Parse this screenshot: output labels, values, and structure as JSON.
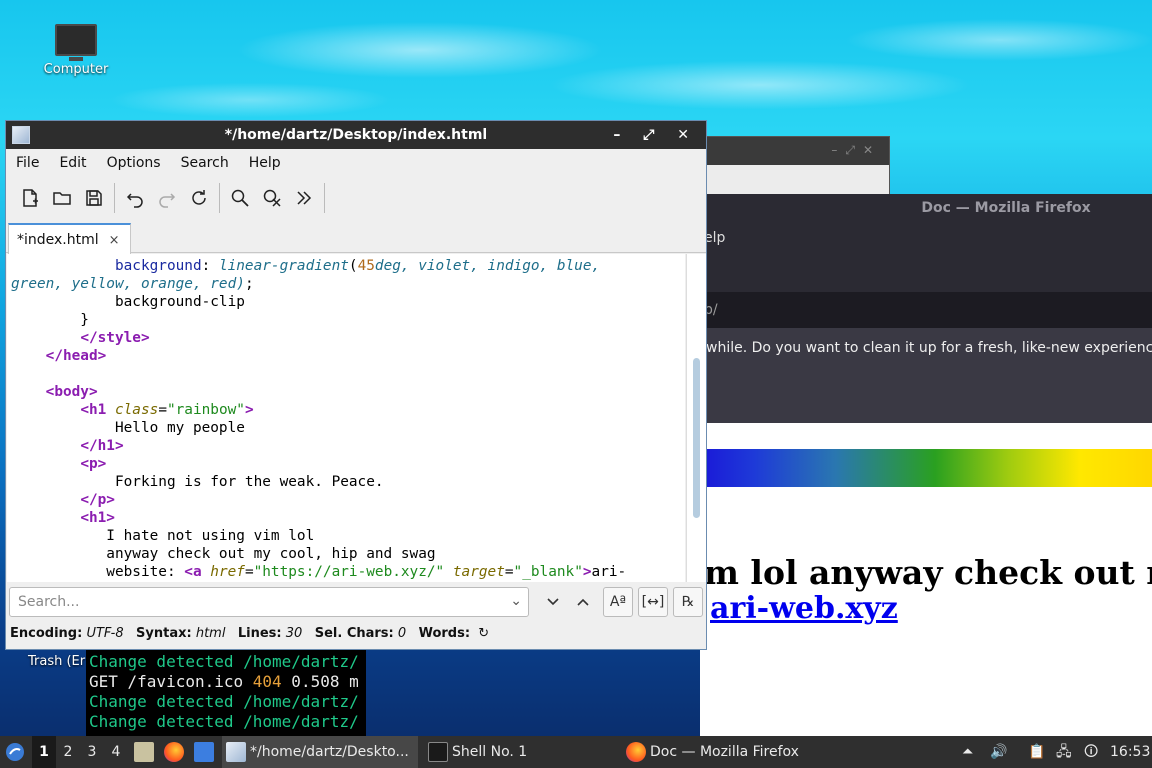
{
  "desktop": {
    "computer_label": "Computer",
    "trash_label": "Trash (Er"
  },
  "firefox": {
    "title": "Doc — Mozilla Firefox",
    "menu_fragment": "elp",
    "url_fragment": "p/",
    "notice": "while. Do you want to clean it up for a fresh, like-new experience? A",
    "heading_fragment": "m lol anyway check out m",
    "link_fragment": "ari-web.xyz"
  },
  "terminal": {
    "lines": [
      {
        "a": "Change detected /home/dartz/",
        "b": "",
        "c": ""
      },
      {
        "a": "GET /favicon.ico ",
        "b": "404",
        "c": " 0.508 m"
      },
      {
        "a": "Change detected /home/dartz/",
        "b": "",
        "c": ""
      },
      {
        "a": "Change detected /home/dartz/",
        "b": "",
        "c": ""
      }
    ]
  },
  "editor": {
    "title": "*/home/dartz/Desktop/index.html",
    "win_buttons": "– ⤢ ✕",
    "menu": [
      "File",
      "Edit",
      "Options",
      "Search",
      "Help"
    ],
    "tab_label": "*index.html",
    "tab_close": "×",
    "search_placeholder": "Search...",
    "status": {
      "encoding_label": "Encoding:",
      "encoding": "UTF-8",
      "syntax_label": "Syntax:",
      "syntax": "html",
      "lines_label": "Lines:",
      "lines": "30",
      "sel_label": "Sel. Chars:",
      "sel": "0",
      "words_label": "Words:"
    }
  },
  "taskbar": {
    "workspaces": [
      "1",
      "2",
      "3",
      "4"
    ],
    "tasks": [
      "*/home/dartz/Deskto...",
      "Shell No. 1",
      "Doc — Mozilla Firefox"
    ],
    "clock": "16:53"
  }
}
